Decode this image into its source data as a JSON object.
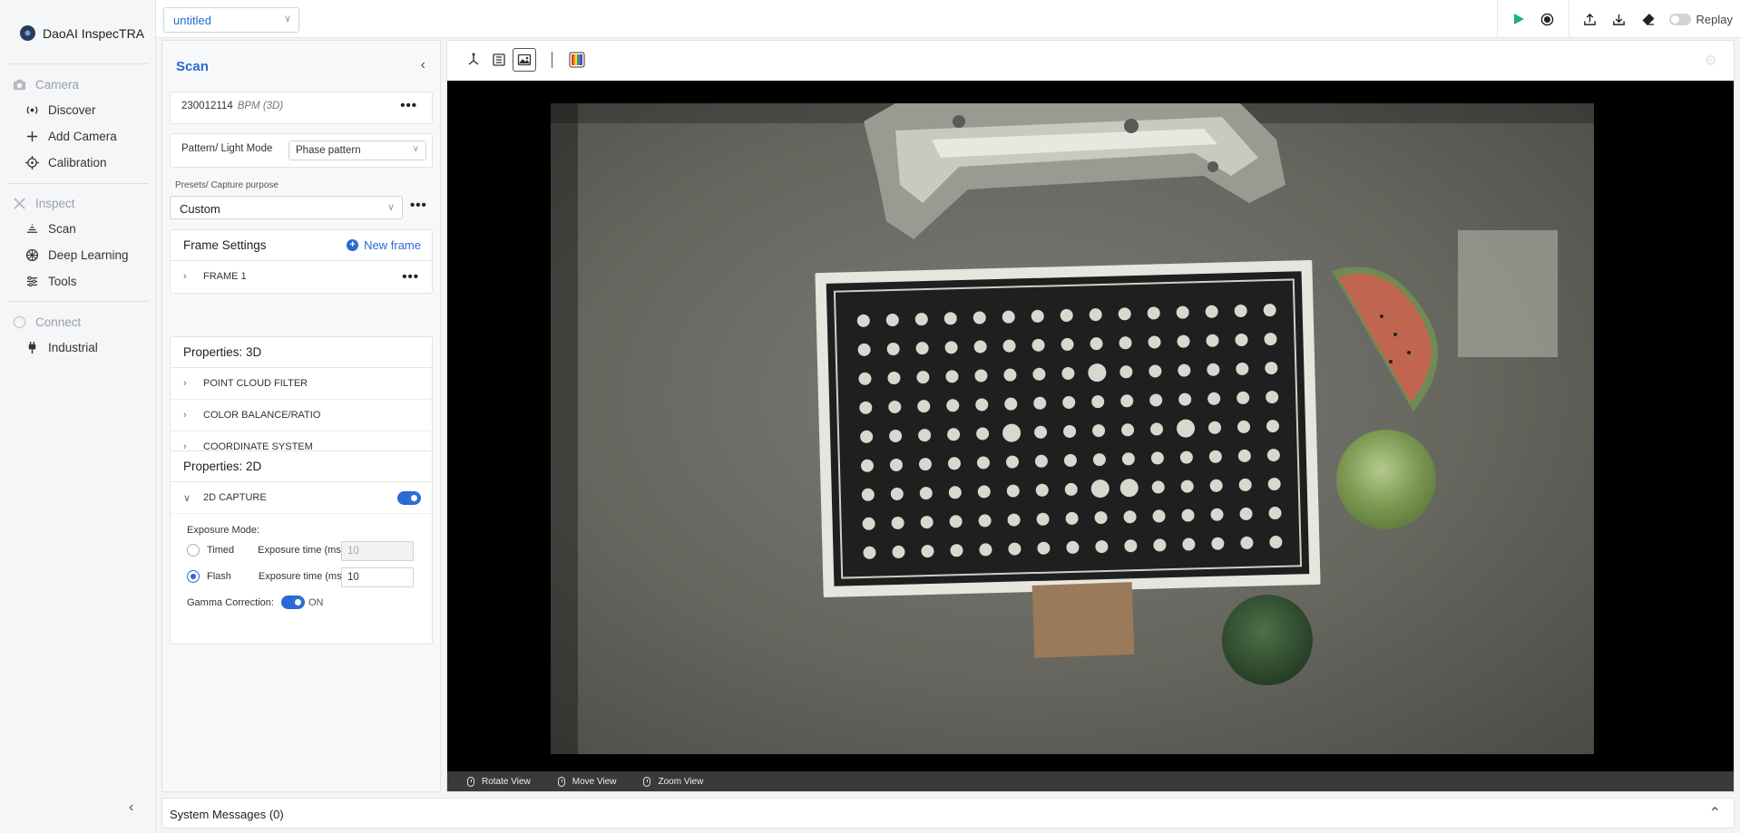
{
  "app": {
    "name": "DaoAI InspecTRA"
  },
  "topbar": {
    "file_name": "untitled",
    "replay_label": "Replay"
  },
  "nav": {
    "sections": [
      {
        "label": "Camera",
        "items": [
          "Discover",
          "Add Camera",
          "Calibration"
        ]
      },
      {
        "label": "Inspect",
        "items": [
          "Scan",
          "Deep Learning",
          "Tools"
        ]
      },
      {
        "label": "Connect",
        "items": [
          "Industrial"
        ]
      }
    ]
  },
  "scan": {
    "title": "Scan",
    "camera_serial": "230012114",
    "camera_model": "BPM (3D)",
    "pattern_label": "Pattern/ Light Mode",
    "pattern_value": "Phase pattern",
    "presets_label": "Presets/ Capture purpose",
    "presets_value": "Custom",
    "frame_settings_label": "Frame Settings",
    "new_frame_label": "New frame",
    "frame_1_label": "FRAME 1",
    "props_3d_label": "Properties: 3D",
    "props_3d_rows": [
      "POINT CLOUD FILTER",
      "COLOR BALANCE/RATIO",
      "COORDINATE SYSTEM"
    ],
    "props_2d_label": "Properties: 2D",
    "capture_2d_label": "2D CAPTURE",
    "exposure_mode_label": "Exposure Mode:",
    "timed_label": "Timed",
    "flash_label": "Flash",
    "exposure_time_label": "Exposure time (ms):",
    "timed_exposure_value": "10",
    "flash_exposure_value": "10",
    "gamma_label": "Gamma Correction:",
    "gamma_state": "ON"
  },
  "viewer": {
    "hints": [
      "Rotate View",
      "Move View",
      "Zoom View"
    ]
  },
  "system_messages": {
    "label": "System Messages (0)"
  },
  "colors": {
    "accent": "#2a6ad3",
    "play": "#1db37a"
  }
}
